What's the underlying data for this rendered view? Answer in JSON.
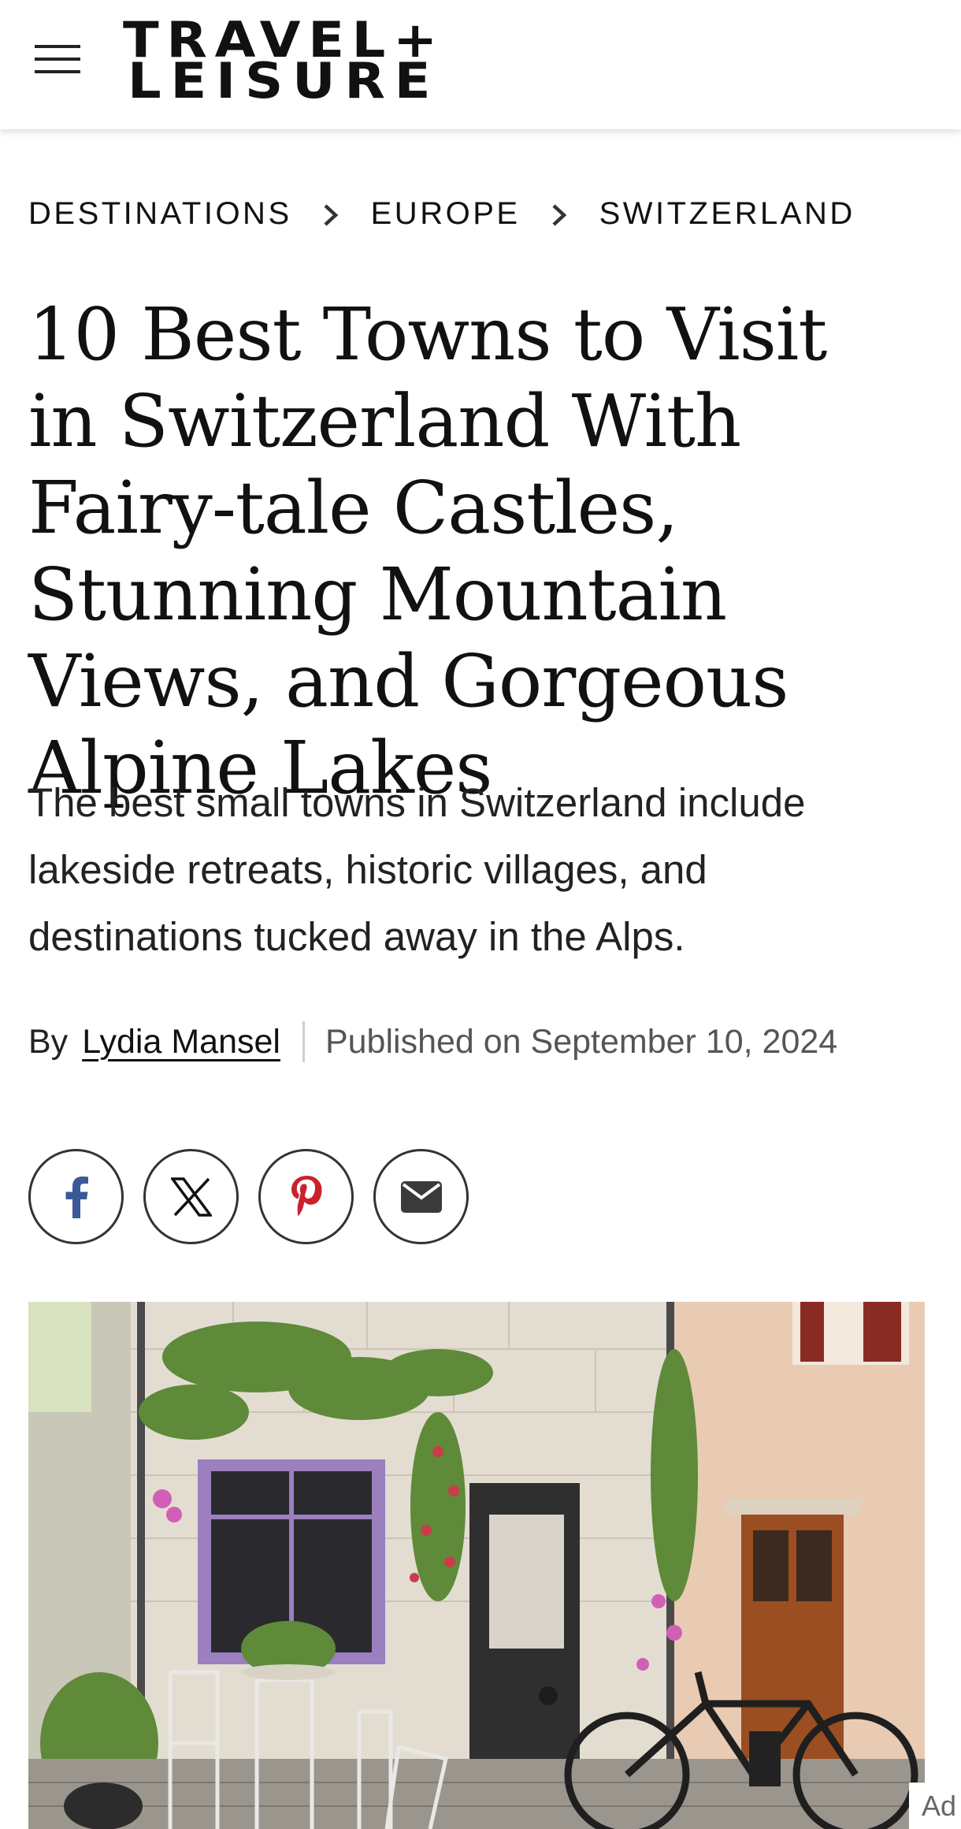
{
  "header": {
    "logo_line1": "TRAVEL+",
    "logo_line2": "LEISURE",
    "menu_icon": "hamburger-menu-icon"
  },
  "breadcrumb": {
    "items": [
      "DESTINATIONS",
      "EUROPE",
      "SWITZERLAND"
    ],
    "separator_icon": "chevron-right-icon"
  },
  "article": {
    "title": "10 Best Towns to Visit in Switzerland With Fairy-tale Castles, Stunning Mountain Views, and Gorgeous Alpine Lakes",
    "subtitle": "The best small towns in Switzerland include lakeside retreats, historic villages, and destinations tucked away in the Alps.",
    "byline_prefix": "By",
    "author": "Lydia Mansel",
    "published": "Published on September 10, 2024"
  },
  "share": {
    "buttons": [
      {
        "name": "facebook",
        "icon": "facebook-icon",
        "color": "#3b5998"
      },
      {
        "name": "x",
        "icon": "x-twitter-icon",
        "color": "#111111"
      },
      {
        "name": "pinterest",
        "icon": "pinterest-icon",
        "color": "#c8232c"
      },
      {
        "name": "email",
        "icon": "envelope-icon",
        "color": "#333333"
      }
    ]
  },
  "hero_image": {
    "subject": "street-facade-with-plants-bicycle-cafe-chairs"
  },
  "ad": {
    "label": "Ad"
  }
}
